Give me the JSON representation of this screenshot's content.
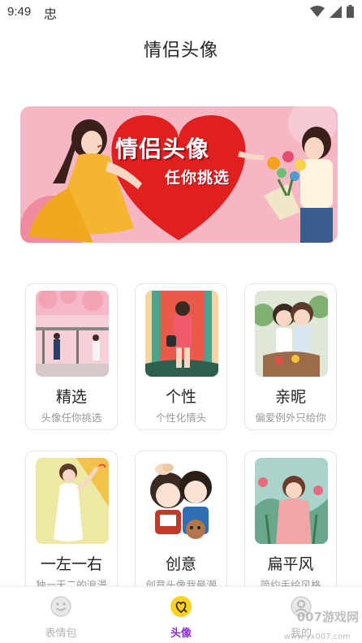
{
  "status_bar": {
    "time": "9:49",
    "app_glyph": "忠"
  },
  "page_title": "情侣头像",
  "banner": {
    "heading": "情侣头像",
    "subheading": "任你挑选"
  },
  "categories": [
    {
      "title": "精选",
      "subtitle": "头像任你挑选"
    },
    {
      "title": "个性",
      "subtitle": "个性化情头"
    },
    {
      "title": "亲昵",
      "subtitle": "偏爱例外只给你"
    },
    {
      "title": "一左一右",
      "subtitle": "独一无二的浪漫"
    },
    {
      "title": "创意",
      "subtitle": "创意头像我最潮"
    },
    {
      "title": "扁平风",
      "subtitle": "简约手绘风格"
    }
  ],
  "bottom_nav": {
    "items": [
      {
        "label": "表情包",
        "active": false,
        "icon": "smiley-icon"
      },
      {
        "label": "头像",
        "active": true,
        "icon": "avatar-heart-icon"
      },
      {
        "label": "我的",
        "active": false,
        "icon": "profile-icon"
      }
    ],
    "active_color": "#8a2be2",
    "inactive_color": "#b5b5b5"
  },
  "watermark": {
    "text": "007游戏网",
    "url_text": "www.yx007.com"
  },
  "colors": {
    "banner_red": "#e0201f",
    "banner_pink": "#f6b7c4",
    "accent_yellow": "#ffd21f"
  }
}
